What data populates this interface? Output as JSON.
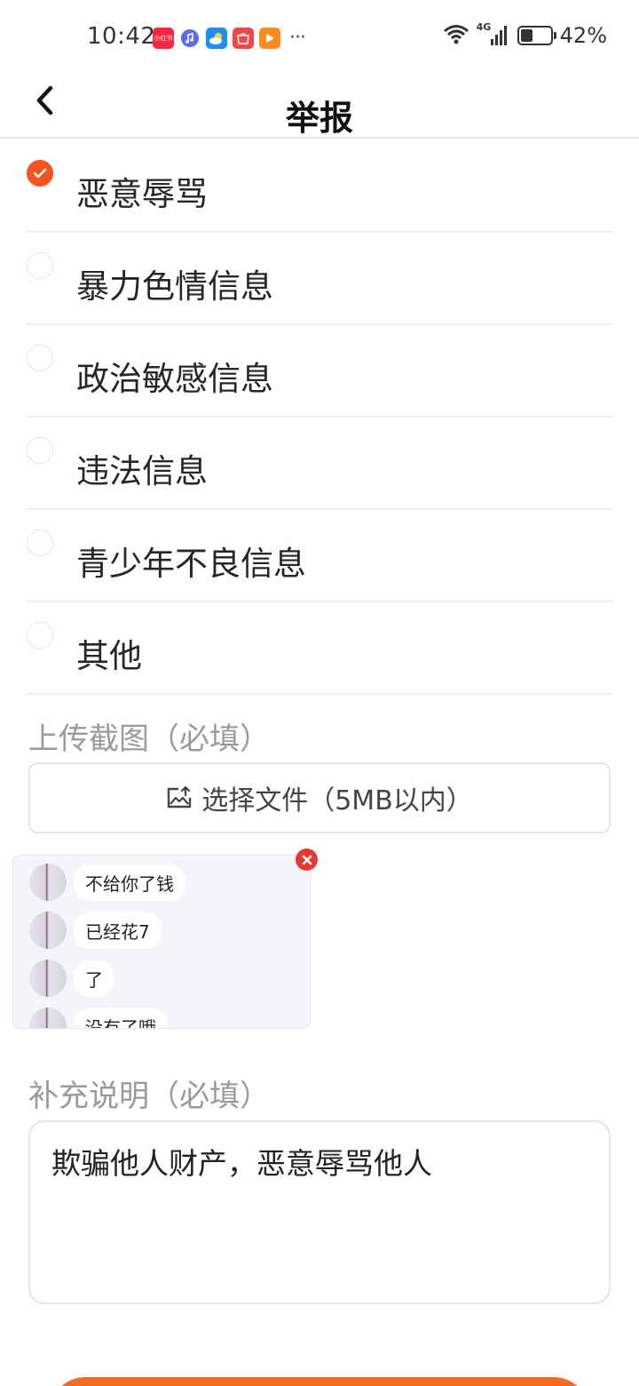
{
  "status_bar": {
    "time": "10:42",
    "app_icons": [
      {
        "name": "xiaohongshu-icon",
        "text": "小红书"
      },
      {
        "name": "music-icon"
      },
      {
        "name": "weather-icon"
      },
      {
        "name": "shop-icon"
      },
      {
        "name": "video-icon"
      }
    ],
    "more": "···",
    "network": "4G",
    "battery_level": 0.42,
    "battery_text": "42%"
  },
  "header": {
    "title": "举报"
  },
  "report_reasons": [
    {
      "label": "恶意辱骂",
      "selected": true
    },
    {
      "label": "暴力色情信息",
      "selected": false
    },
    {
      "label": "政治敏感信息",
      "selected": false
    },
    {
      "label": "违法信息",
      "selected": false
    },
    {
      "label": "青少年不良信息",
      "selected": false
    },
    {
      "label": "其他",
      "selected": false
    }
  ],
  "upload": {
    "section_label": "上传截图（必填）",
    "button_label": "选择文件（5MB以内）",
    "thumbnail_messages": [
      "不给你了钱",
      "已经花7",
      "了",
      "没有了哦"
    ]
  },
  "note": {
    "section_label": "补充说明（必填）",
    "value": "欺骗他人财产，恶意辱骂他人"
  },
  "colors": {
    "accent": "#f55221",
    "submit": "#f86a1f",
    "close": "#e53935"
  }
}
